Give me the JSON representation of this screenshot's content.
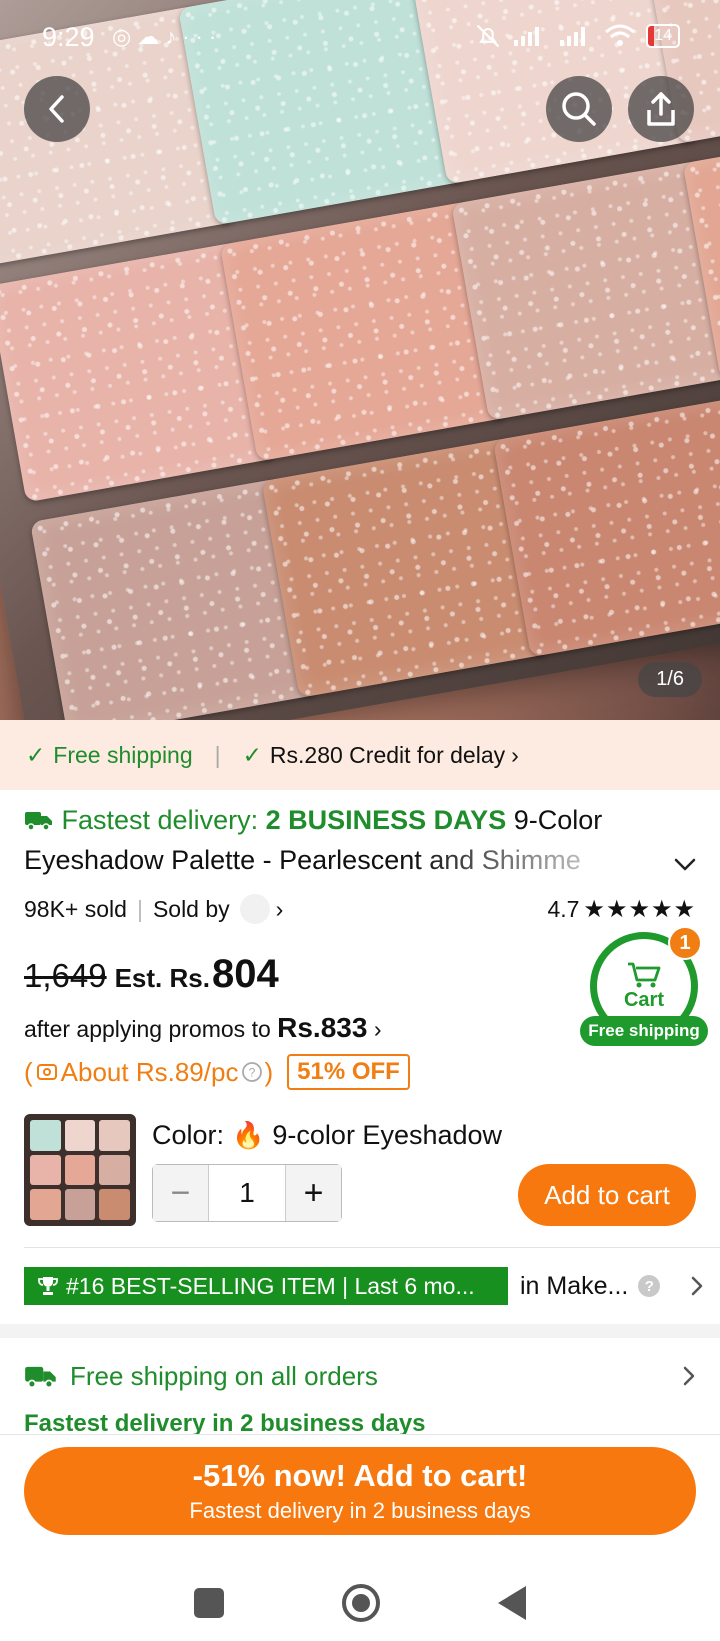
{
  "status_bar": {
    "time": "9:29",
    "left_icons": [
      "whatsapp-icon",
      "cloud-icon",
      "tiktok-icon",
      "more-dots-icon"
    ],
    "battery": "14"
  },
  "hero": {
    "image_counter": "1/6",
    "pan_colors": [
      "#e9d3cb",
      "#bfe1d8",
      "#eed6cf",
      "#e7c8bf",
      "#e8b3a9",
      "#e5a796",
      "#d7aea2",
      "#e2a692",
      "#c7a197",
      "#c98c71",
      "#c98670",
      "#d8b1a4"
    ]
  },
  "benefits": {
    "free_shipping": "Free shipping",
    "credit": "Rs.280 Credit for delay"
  },
  "product": {
    "fast_label": "Fastest delivery:",
    "fast_days": "2 BUSINESS DAYS",
    "title_start": "9-Color",
    "title_line2": "Eyeshadow Palette - Pearlescent and Shimme",
    "sold": "98K+ sold",
    "sold_by": "Sold by",
    "rating": "4.7",
    "stars": "★★★★★"
  },
  "price": {
    "old": "1,649",
    "est": "Est. Rs.",
    "current": "804",
    "promo_text": "after applying promos to",
    "promo_amount": "Rs.833",
    "unit_open": "(",
    "unit_text": "About Rs.89/pc",
    "unit_close": ")",
    "off": "51% OFF"
  },
  "cart": {
    "label": "Cart",
    "count": "1",
    "pill": "Free shipping"
  },
  "variant": {
    "color_label": "Color:",
    "color_value": "9-color Eyeshadow",
    "qty": "1",
    "minus": "−",
    "plus": "+",
    "add_to_cart": "Add to cart"
  },
  "best_seller": {
    "rank": "#16 BEST-SELLING ITEM | Last 6 mo...",
    "category": "in Make...",
    "help": "?"
  },
  "shipping": {
    "title": "Free shipping on all orders",
    "subtitle": "Fastest delivery in 2 business days"
  },
  "bottom_cta": {
    "line1": "-51% now! Add to cart!",
    "line2": "Fastest delivery in 2 business days"
  }
}
